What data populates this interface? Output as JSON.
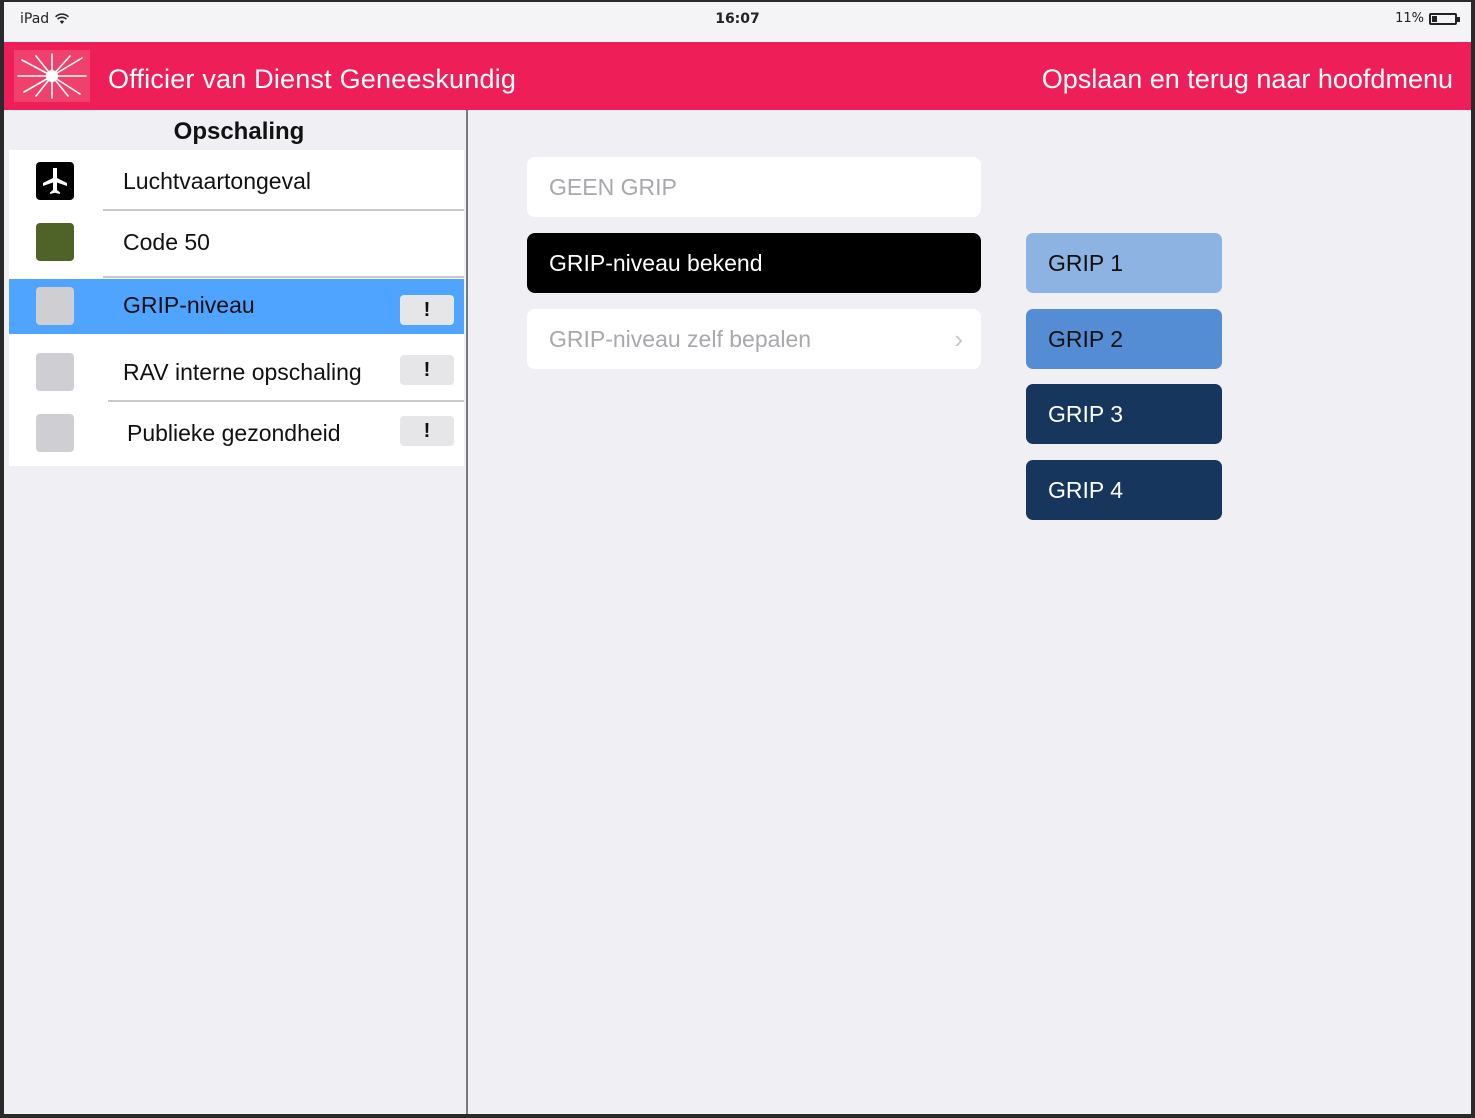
{
  "status": {
    "device": "iPad",
    "time": "16:07",
    "battery": "11%"
  },
  "navbar": {
    "title": "Officier van Dienst Geneeskundig",
    "action": "Opslaan en terug naar hoofdmenu",
    "color": "#ee1e58"
  },
  "sidebar": {
    "header": "Opschaling",
    "items": [
      {
        "label": "Luchtvaartongeval",
        "icon": "airplane-icon",
        "icon_color": "#000000",
        "badge": ""
      },
      {
        "label": "Code 50",
        "icon": "status-square-icon",
        "icon_color": "#4f6228",
        "badge": ""
      },
      {
        "label": "GRIP-niveau",
        "icon": "status-square-icon",
        "icon_color": "#cfcfd3",
        "badge": "!",
        "selected": true
      },
      {
        "label": "RAV interne opschaling",
        "icon": "status-square-icon",
        "icon_color": "#cfcfd3",
        "badge": "!"
      },
      {
        "label": "Publieke gezondheid",
        "icon": "status-square-icon",
        "icon_color": "#cfcfd3",
        "badge": "!"
      }
    ]
  },
  "options": [
    {
      "label": "GEEN GRIP",
      "state": "muted"
    },
    {
      "label": "GRIP-niveau bekend",
      "state": "active"
    },
    {
      "label": "GRIP-niveau zelf bepalen",
      "state": "muted",
      "chevron": "›"
    }
  ],
  "grip_levels": [
    {
      "label": "GRIP 1",
      "bg": "#8db3e2",
      "fg": "#111111"
    },
    {
      "label": "GRIP 2",
      "bg": "#548dd4",
      "fg": "#111111"
    },
    {
      "label": "GRIP 3",
      "bg": "#17365d",
      "fg": "#ffffff"
    },
    {
      "label": "GRIP 4",
      "bg": "#17365d",
      "fg": "#ffffff"
    }
  ]
}
